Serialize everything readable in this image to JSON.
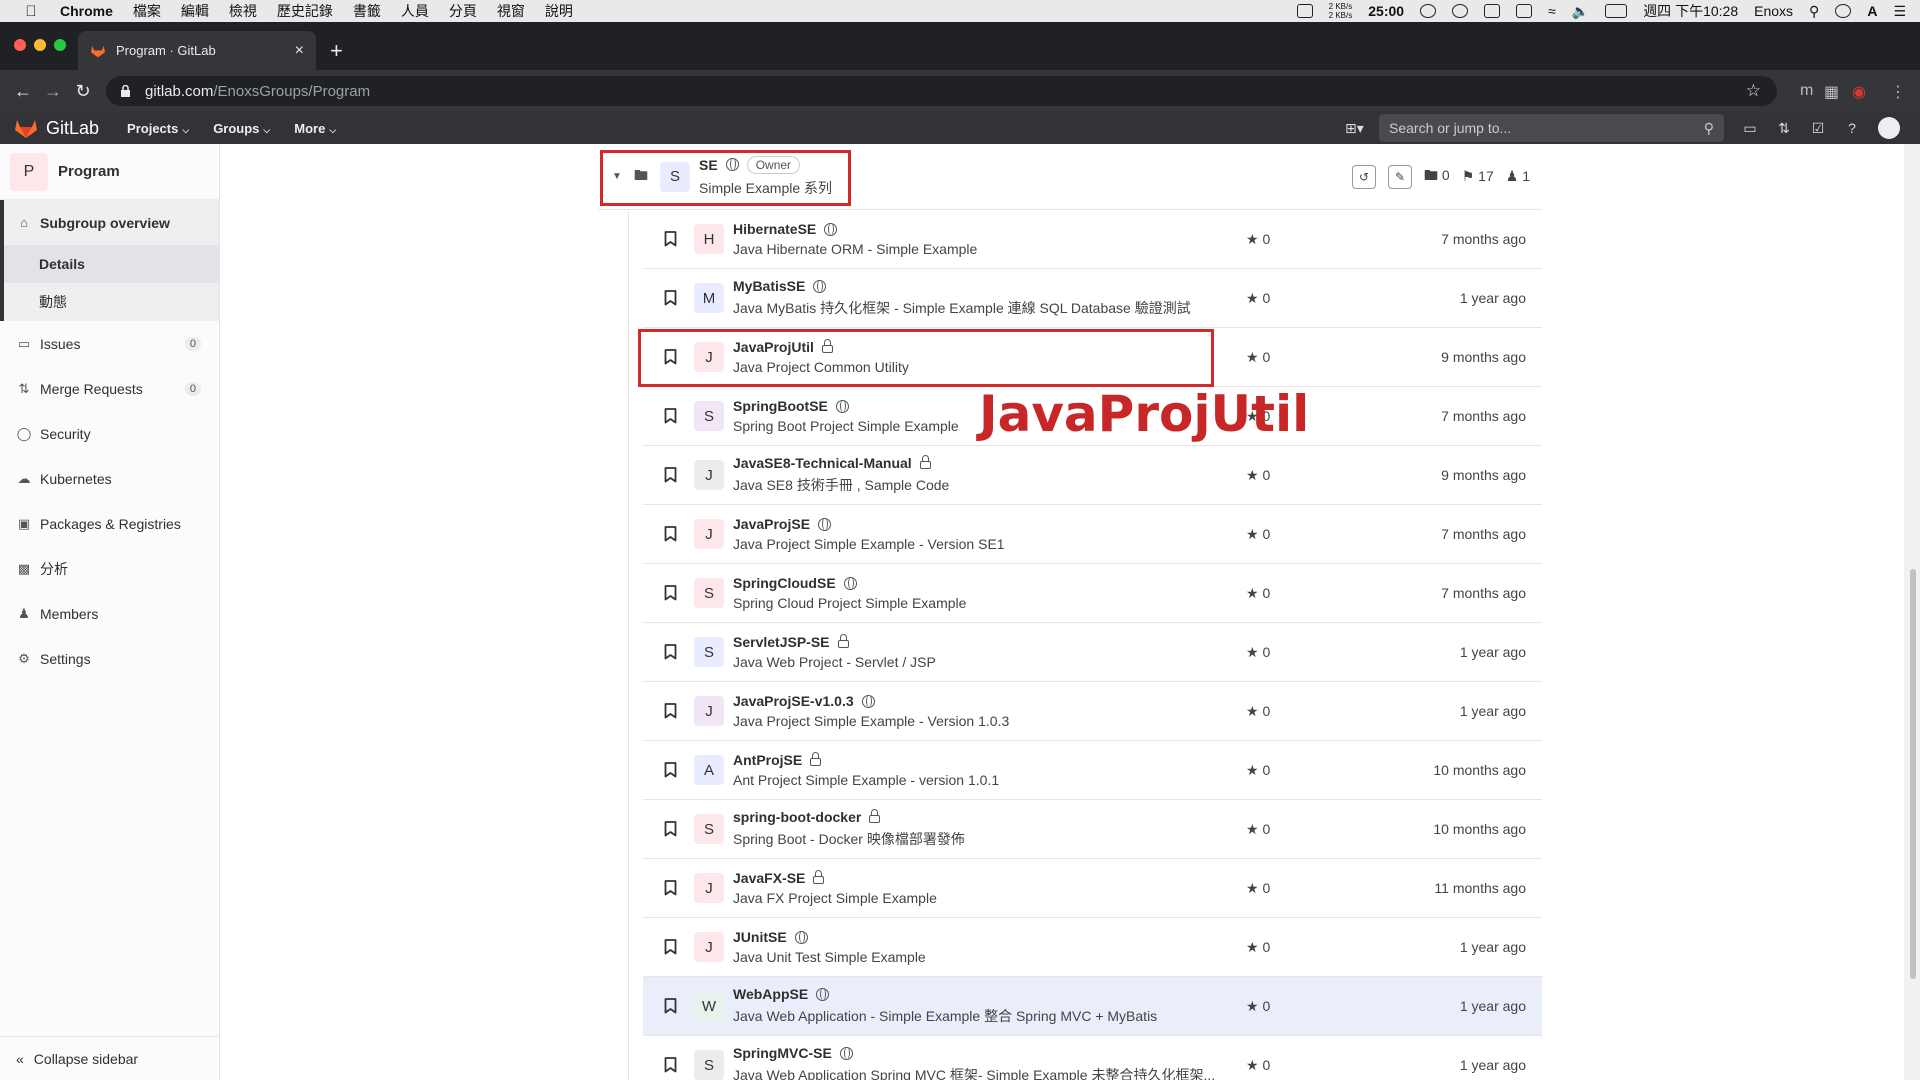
{
  "menubar": {
    "app": "Chrome",
    "items": [
      "檔案",
      "編輯",
      "檢視",
      "歷史記錄",
      "書籤",
      "人員",
      "分頁",
      "視窗",
      "說明"
    ],
    "net_up": "2 KB/s",
    "net_down": "2 KB/s",
    "timer": "25:00",
    "clock": "週四 下午10:28",
    "user": "Enoxs"
  },
  "browser": {
    "tab_title": "Program · GitLab",
    "url_host": "gitlab.com",
    "url_path": "/EnoxsGroups/Program"
  },
  "gitlab": {
    "brand": "GitLab",
    "nav": [
      "Projects",
      "Groups",
      "More"
    ],
    "search_placeholder": "Search or jump to..."
  },
  "sidebar": {
    "context_initial": "P",
    "context_name": "Program",
    "overview": "Subgroup overview",
    "overview_subs": [
      "Details",
      "動態"
    ],
    "items": [
      {
        "label": "Issues",
        "badge": "0",
        "icon": "issues-icon"
      },
      {
        "label": "Merge Requests",
        "badge": "0",
        "icon": "merge-request-icon"
      },
      {
        "label": "Security",
        "icon": "shield-icon"
      },
      {
        "label": "Kubernetes",
        "icon": "kubernetes-icon"
      },
      {
        "label": "Packages & Registries",
        "icon": "package-icon"
      },
      {
        "label": "分析",
        "icon": "chart-icon"
      },
      {
        "label": "Members",
        "icon": "members-icon"
      },
      {
        "label": "Settings",
        "icon": "gear-icon"
      }
    ],
    "collapse": "Collapse sidebar"
  },
  "group": {
    "initial": "S",
    "name": "SE",
    "role": "Owner",
    "description": "Simple Example 系列",
    "subgroups": "0",
    "projects": "17",
    "members": "1"
  },
  "projects": [
    {
      "initial": "H",
      "name": "HibernateSE",
      "visibility": "public",
      "description": "Java Hibernate ORM - Simple Example",
      "stars": "0",
      "updated": "7 months ago",
      "tile": "pink"
    },
    {
      "initial": "M",
      "name": "MyBatisSE",
      "visibility": "public",
      "description": "Java MyBatis 持久化框架 - Simple Example 連線 SQL Database 驗證測試",
      "stars": "0",
      "updated": "1 year ago",
      "tile": "blue"
    },
    {
      "initial": "J",
      "name": "JavaProjUtil",
      "visibility": "private",
      "description": "Java Project Common Utility",
      "stars": "0",
      "updated": "9 months ago",
      "tile": "pink"
    },
    {
      "initial": "S",
      "name": "SpringBootSE",
      "visibility": "public",
      "description": "Spring Boot Project Simple Example",
      "stars": "0",
      "updated": "7 months ago",
      "tile": "mauve"
    },
    {
      "initial": "J",
      "name": "JavaSE8-Technical-Manual",
      "visibility": "private",
      "description": "Java SE8 技術手冊 , Sample Code",
      "stars": "0",
      "updated": "9 months ago",
      "tile": "gray"
    },
    {
      "initial": "J",
      "name": "JavaProjSE",
      "visibility": "public",
      "description": "Java Project Simple Example - Version SE1",
      "stars": "0",
      "updated": "7 months ago",
      "tile": "pink"
    },
    {
      "initial": "S",
      "name": "SpringCloudSE",
      "visibility": "public",
      "description": "Spring Cloud Project Simple Example",
      "stars": "0",
      "updated": "7 months ago",
      "tile": "pink"
    },
    {
      "initial": "S",
      "name": "ServletJSP-SE",
      "visibility": "private",
      "description": "Java Web Project - Servlet / JSP",
      "stars": "0",
      "updated": "1 year ago",
      "tile": "blue"
    },
    {
      "initial": "J",
      "name": "JavaProjSE-v1.0.3",
      "visibility": "public",
      "description": "Java Project Simple Example - Version 1.0.3",
      "stars": "0",
      "updated": "1 year ago",
      "tile": "mauve"
    },
    {
      "initial": "A",
      "name": "AntProjSE",
      "visibility": "private",
      "description": "Ant Project Simple Example - version 1.0.1",
      "stars": "0",
      "updated": "10 months ago",
      "tile": "blue"
    },
    {
      "initial": "S",
      "name": "spring-boot-docker",
      "visibility": "private",
      "description": "Spring Boot - Docker 映像檔部署發佈",
      "stars": "0",
      "updated": "10 months ago",
      "tile": "pink"
    },
    {
      "initial": "J",
      "name": "JavaFX-SE",
      "visibility": "private",
      "description": "Java FX Project Simple Example",
      "stars": "0",
      "updated": "11 months ago",
      "tile": "pink"
    },
    {
      "initial": "J",
      "name": "JUnitSE",
      "visibility": "public",
      "description": "Java Unit Test Simple Example",
      "stars": "0",
      "updated": "1 year ago",
      "tile": "pink"
    },
    {
      "initial": "W",
      "name": "WebAppSE",
      "visibility": "public",
      "description": "Java Web Application - Simple Example 整合 Spring MVC + MyBatis",
      "stars": "0",
      "updated": "1 year ago",
      "tile": "green"
    },
    {
      "initial": "S",
      "name": "SpringMVC-SE",
      "visibility": "public",
      "description": "Java Web Application Spring MVC 框架- Simple Example 未整合持久化框架...",
      "stars": "0",
      "updated": "1 year ago",
      "tile": "gray"
    }
  ],
  "overlay_text": "JavaProjUtil",
  "colors": {
    "annotation": "#d22a2a",
    "gitlab_orange": "#fc6d26"
  }
}
